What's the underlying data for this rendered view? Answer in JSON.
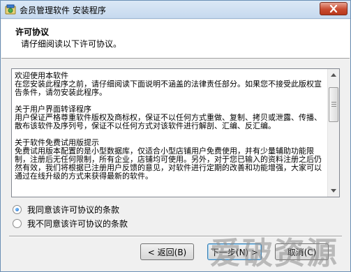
{
  "window": {
    "title": "会员管理软件 安装程序"
  },
  "header": {
    "title": "许可协议",
    "subtitle": "请仔细阅读以下许可协议。"
  },
  "license": {
    "text": "欢迎使用本软件\n在您安装此程序之前，请仔细阅读下面说明不涵盖的法律责任部分。如果您不接受此版权宣告条件，请勿安装此程序。\n\n关于用户界面转译程序\n用户保证严格尊重软件版权及商标权，保证不以任何方式重做、复制、拷贝或泄露、传播、散布该软件及序列号，保证不以任何方式对该软件进行解剖、汇编、反汇编。\n\n关于软件免费试用版提示\n免费试用版本配置的是小型数据库，仅适合小型店铺用户免费使用，并有少量辅助功能限制，注册后无任何限制，所有企业，店铺均可使用。另外，对于您已输入的资料注册之后仍然有效，我们将根据已注册用户反馈的意见，对软件进行定期的改善和功能增强，大家可以通过在线升级的方式来获得最新的软件。"
  },
  "options": {
    "accept": "我同意该许可协议的条款",
    "decline": "我不同意该许可协议的条款",
    "selected": "accept"
  },
  "buttons": {
    "back": "< 返回(B)",
    "next": "下一步(N) >",
    "cancel": "取消(C)"
  },
  "watermark": "爱破资源",
  "colors": {
    "close_button": "#c94b2f",
    "titlebar": "#c6d9ee",
    "radio_dot": "#1a64c8"
  }
}
